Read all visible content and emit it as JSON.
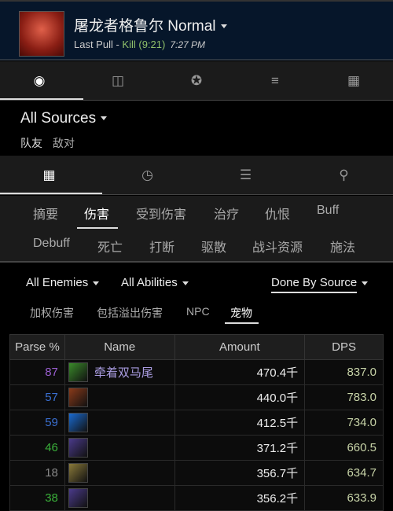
{
  "header": {
    "boss": "屠龙者格鲁尔",
    "difficulty": "Normal",
    "last_pull": "Last Pull - ",
    "kill": "Kill (9:21)",
    "time": "7:27 PM"
  },
  "top_tabs": [
    {
      "icon": "eye-icon"
    },
    {
      "icon": "compare-icon"
    },
    {
      "icon": "puzzle-icon"
    },
    {
      "icon": "sort-icon"
    },
    {
      "icon": "film-icon"
    }
  ],
  "sources": {
    "label": "All Sources",
    "friendly": "队友",
    "hostile": "敌对"
  },
  "view_tabs": [
    {
      "icon": "grid-icon"
    },
    {
      "icon": "clock-icon"
    },
    {
      "icon": "list-icon"
    },
    {
      "icon": "location-pin-icon"
    }
  ],
  "sub_tabs_row1": [
    "摘要",
    "伤害",
    "受到伤害",
    "治疗",
    "仇恨",
    "Buff"
  ],
  "sub_tabs_row2": [
    "Debuff",
    "死亡",
    "打断",
    "驱散",
    "战斗资源",
    "施法"
  ],
  "filters": {
    "enemies": "All Enemies",
    "abilities": "All Abilities",
    "mode": "Done By Source"
  },
  "options": [
    "加权伤害",
    "包括溢出伤害",
    "NPC",
    "宠物"
  ],
  "table": {
    "headers": [
      "Parse %",
      "Name",
      "Amount",
      "DPS"
    ],
    "rows": [
      {
        "parse": "87",
        "parse_color": "#9a5fd0",
        "name": "牵着双马尾",
        "amount": "470.4千",
        "dps": "837.0",
        "icon_color": "#3a8a2a"
      },
      {
        "parse": "57",
        "parse_color": "#3a6fd0",
        "name": "",
        "amount": "440.0千",
        "dps": "783.0",
        "icon_color": "#8a3a1a"
      },
      {
        "parse": "59",
        "parse_color": "#3a6fd0",
        "name": "",
        "amount": "412.5千",
        "dps": "734.0",
        "icon_color": "#1a6ad0"
      },
      {
        "parse": "46",
        "parse_color": "#3ab03a",
        "name": "",
        "amount": "371.2千",
        "dps": "660.5",
        "icon_color": "#4a3a8a"
      },
      {
        "parse": "18",
        "parse_color": "#888888",
        "name": "",
        "amount": "356.7千",
        "dps": "634.7",
        "icon_color": "#8a7a3a"
      },
      {
        "parse": "38",
        "parse_color": "#3ab03a",
        "name": "",
        "amount": "356.2千",
        "dps": "633.9",
        "icon_color": "#4a3a8a"
      }
    ]
  }
}
